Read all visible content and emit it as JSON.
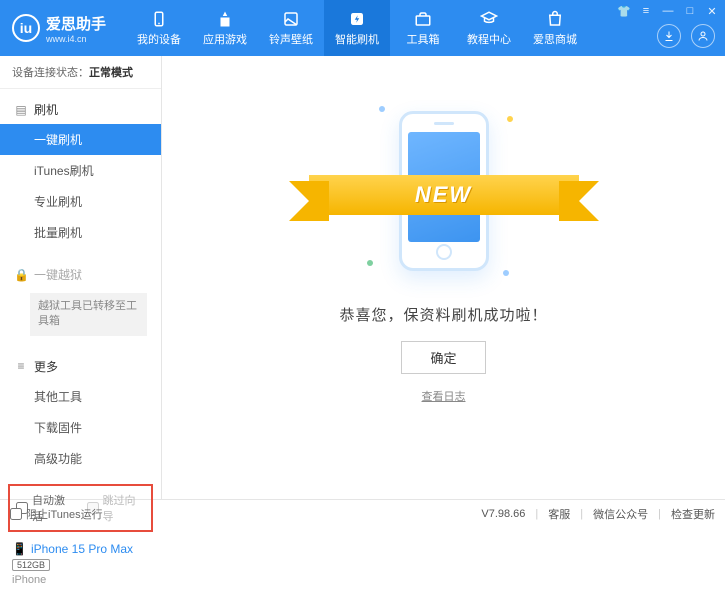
{
  "header": {
    "logo_glyph": "iu",
    "app_name": "爱思助手",
    "site": "www.i4.cn",
    "nav": [
      {
        "label": "我的设备"
      },
      {
        "label": "应用游戏"
      },
      {
        "label": "铃声壁纸"
      },
      {
        "label": "智能刷机"
      },
      {
        "label": "工具箱"
      },
      {
        "label": "教程中心"
      },
      {
        "label": "爱思商城"
      }
    ]
  },
  "sidebar": {
    "status_label": "设备连接状态：",
    "status_value": "正常模式",
    "section_flash": {
      "title": "刷机",
      "items": [
        "一键刷机",
        "iTunes刷机",
        "专业刷机",
        "批量刷机"
      ]
    },
    "section_jailbreak": {
      "title": "一键越狱",
      "note": "越狱工具已转移至工具箱"
    },
    "section_more": {
      "title": "更多",
      "items": [
        "其他工具",
        "下载固件",
        "高级功能"
      ]
    },
    "checkbox_auto_activate": "自动激活",
    "checkbox_skip_guide": "跳过向导",
    "device": {
      "name": "iPhone 15 Pro Max",
      "storage": "512GB",
      "type": "iPhone"
    }
  },
  "main": {
    "ribbon": "NEW",
    "success": "恭喜您，保资料刷机成功啦！",
    "ok": "确定",
    "view_log": "查看日志"
  },
  "footer": {
    "block_itunes": "阻止iTunes运行",
    "version": "V7.98.66",
    "support": "客服",
    "wechat": "微信公众号",
    "check_update": "检查更新"
  }
}
